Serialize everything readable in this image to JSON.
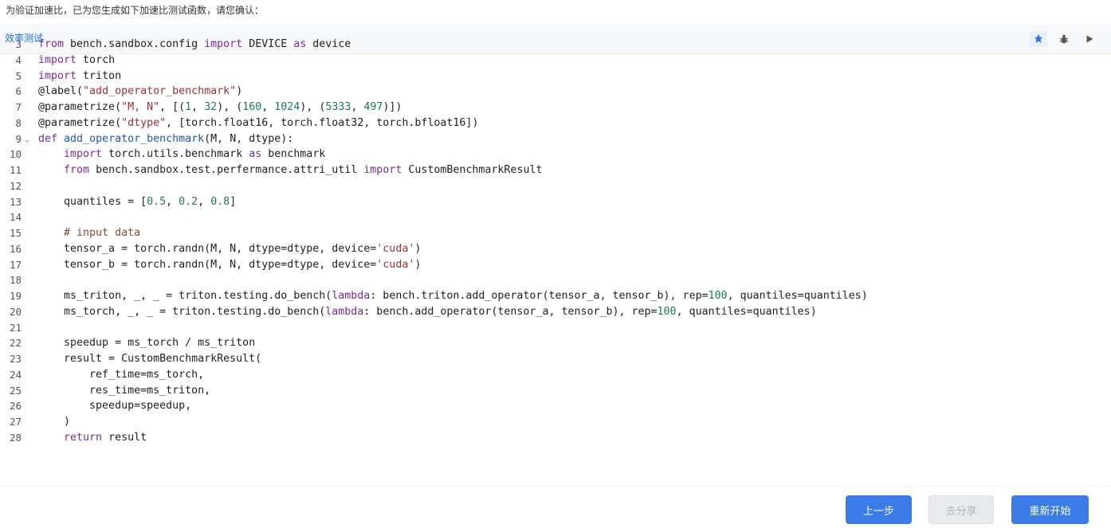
{
  "intro_text": "为验证加速比，已为您生成如下加速比测试函数，请您确认：",
  "panel": {
    "title": "效率测试",
    "tools": [
      {
        "icon": "pin-icon",
        "active": true
      },
      {
        "icon": "bug-icon",
        "active": false
      },
      {
        "icon": "play-icon",
        "active": false
      }
    ]
  },
  "code_lines": [
    {
      "n": "3",
      "tokens": [
        [
          "kw",
          "from"
        ],
        [
          "t",
          " bench.sandbox.config "
        ],
        [
          "kw",
          "import"
        ],
        [
          "t",
          " DEVICE "
        ],
        [
          "kw",
          "as"
        ],
        [
          "t",
          " device"
        ]
      ]
    },
    {
      "n": "4",
      "tokens": [
        [
          "kw",
          "import"
        ],
        [
          "t",
          " torch"
        ]
      ]
    },
    {
      "n": "5",
      "tokens": [
        [
          "kw",
          "import"
        ],
        [
          "t",
          " triton"
        ]
      ]
    },
    {
      "n": "6",
      "tokens": [
        [
          "t",
          "@label("
        ],
        [
          "str",
          "\"add_operator_benchmark\""
        ],
        [
          "t",
          ")"
        ]
      ]
    },
    {
      "n": "7",
      "tokens": [
        [
          "t",
          "@parametrize("
        ],
        [
          "str",
          "\"M, N\""
        ],
        [
          "t",
          ", [("
        ],
        [
          "num",
          "1"
        ],
        [
          "t",
          ", "
        ],
        [
          "num",
          "32"
        ],
        [
          "t",
          "), ("
        ],
        [
          "num",
          "160"
        ],
        [
          "t",
          ", "
        ],
        [
          "num",
          "1024"
        ],
        [
          "t",
          "), ("
        ],
        [
          "num",
          "5333"
        ],
        [
          "t",
          ", "
        ],
        [
          "num",
          "497"
        ],
        [
          "t",
          ")])"
        ]
      ]
    },
    {
      "n": "8",
      "tokens": [
        [
          "t",
          "@parametrize("
        ],
        [
          "str",
          "\"dtype\""
        ],
        [
          "t",
          ", [torch.float16, torch.float32, torch.bfloat16])"
        ]
      ]
    },
    {
      "n": "9",
      "fold": true,
      "tokens": [
        [
          "kw",
          "def"
        ],
        [
          "t",
          " "
        ],
        [
          "fn",
          "add_operator_benchmark"
        ],
        [
          "t",
          "(M, N, dtype):"
        ]
      ]
    },
    {
      "n": "10",
      "tokens": [
        [
          "t",
          "    "
        ],
        [
          "kw",
          "import"
        ],
        [
          "t",
          " torch.utils.benchmark "
        ],
        [
          "kw",
          "as"
        ],
        [
          "t",
          " benchmark"
        ]
      ]
    },
    {
      "n": "11",
      "tokens": [
        [
          "t",
          "    "
        ],
        [
          "kw",
          "from"
        ],
        [
          "t",
          " bench.sandbox.test.perfermance.attri_util "
        ],
        [
          "kw",
          "import"
        ],
        [
          "t",
          " CustomBenchmarkResult"
        ]
      ]
    },
    {
      "n": "12",
      "tokens": []
    },
    {
      "n": "13",
      "tokens": [
        [
          "t",
          "    quantiles = ["
        ],
        [
          "num",
          "0.5"
        ],
        [
          "t",
          ", "
        ],
        [
          "num",
          "0.2"
        ],
        [
          "t",
          ", "
        ],
        [
          "num",
          "0.8"
        ],
        [
          "t",
          "]"
        ]
      ]
    },
    {
      "n": "14",
      "tokens": []
    },
    {
      "n": "15",
      "tokens": [
        [
          "t",
          "    "
        ],
        [
          "cm",
          "# input data"
        ]
      ]
    },
    {
      "n": "16",
      "tokens": [
        [
          "t",
          "    tensor_a = torch.randn(M, N, dtype=dtype, device="
        ],
        [
          "str",
          "'cuda'"
        ],
        [
          "t",
          ")"
        ]
      ]
    },
    {
      "n": "17",
      "tokens": [
        [
          "t",
          "    tensor_b = torch.randn(M, N, dtype=dtype, device="
        ],
        [
          "str",
          "'cuda'"
        ],
        [
          "t",
          ")"
        ]
      ]
    },
    {
      "n": "18",
      "tokens": []
    },
    {
      "n": "19",
      "tokens": [
        [
          "t",
          "    ms_triton, _, _ = triton.testing.do_bench("
        ],
        [
          "kw",
          "lambda"
        ],
        [
          "t",
          ": bench.triton.add_operator(tensor_a, tensor_b), rep="
        ],
        [
          "num",
          "100"
        ],
        [
          "t",
          ", quantiles=quantiles)"
        ]
      ]
    },
    {
      "n": "20",
      "tokens": [
        [
          "t",
          "    ms_torch, _, _ = triton.testing.do_bench("
        ],
        [
          "kw",
          "lambda"
        ],
        [
          "t",
          ": bench.add_operator(tensor_a, tensor_b), rep="
        ],
        [
          "num",
          "100"
        ],
        [
          "t",
          ", quantiles=quantiles)"
        ]
      ]
    },
    {
      "n": "21",
      "tokens": []
    },
    {
      "n": "22",
      "tokens": [
        [
          "t",
          "    speedup = ms_torch / ms_triton"
        ]
      ]
    },
    {
      "n": "23",
      "tokens": [
        [
          "t",
          "    result = CustomBenchmarkResult("
        ]
      ]
    },
    {
      "n": "24",
      "tokens": [
        [
          "t",
          "        ref_time=ms_torch,"
        ]
      ]
    },
    {
      "n": "25",
      "tokens": [
        [
          "t",
          "        res_time=ms_triton,"
        ]
      ]
    },
    {
      "n": "26",
      "tokens": [
        [
          "t",
          "        speedup=speedup,"
        ]
      ]
    },
    {
      "n": "27",
      "tokens": [
        [
          "t",
          "    )"
        ]
      ]
    },
    {
      "n": "28",
      "tokens": [
        [
          "t",
          "    "
        ],
        [
          "kw",
          "return"
        ],
        [
          "t",
          " result"
        ]
      ]
    }
  ],
  "footer": {
    "prev_label": "上一步",
    "share_label": "去分享",
    "restart_label": "重新开始"
  }
}
